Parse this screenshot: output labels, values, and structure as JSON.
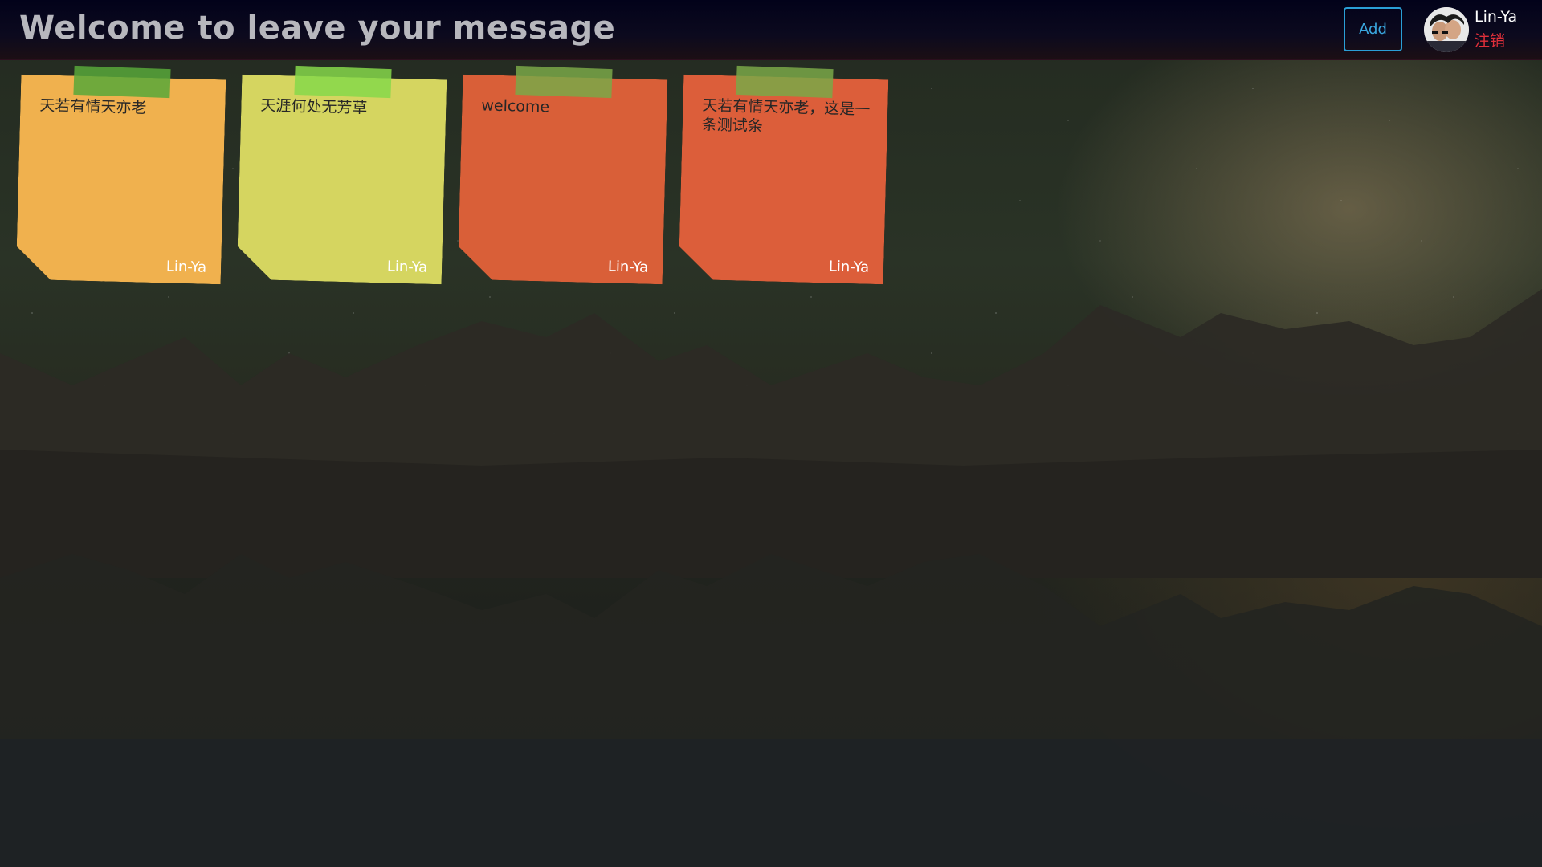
{
  "header": {
    "title": "Welcome to leave your message",
    "add_label": "Add",
    "username": "Lin-Ya",
    "logout_label": "注销"
  },
  "notes": [
    {
      "text": "天若有情天亦老",
      "author": "Lin-Ya",
      "color": "#f0b14e",
      "tape_color": "#58a83a"
    },
    {
      "text": "天涯何处无芳草",
      "author": "Lin-Ya",
      "color": "#d5d560",
      "tape_color": "#86d84a"
    },
    {
      "text": "welcome",
      "author": "Lin-Ya",
      "color": "#d95f38",
      "tape_color": "#7aa848"
    },
    {
      "text": "天若有情天亦老，这是一条测试条",
      "author": "Lin-Ya",
      "color": "#dc5e3a",
      "tape_color": "#7aa848"
    }
  ],
  "colors": {
    "header_bg": "#05041a",
    "title_color": "#b7b7bd",
    "add_button": "#2a9fd6",
    "logout_color": "#e0303a"
  }
}
